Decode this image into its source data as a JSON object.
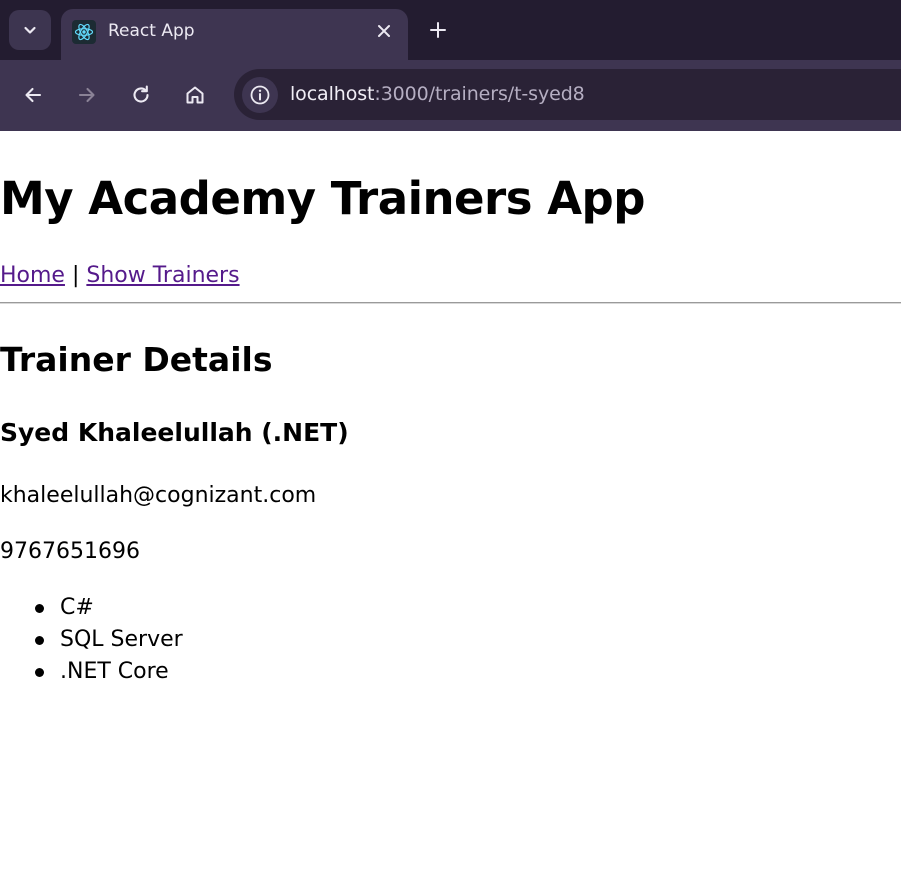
{
  "browser": {
    "tab": {
      "title": "React App",
      "favicon": "react-logo-icon",
      "close_icon": "close-icon"
    },
    "tab_search_icon": "chevron-down-icon",
    "new_tab_icon": "plus-icon",
    "toolbar": {
      "back_icon": "arrow-left-icon",
      "forward_icon": "arrow-right-icon",
      "reload_icon": "reload-icon",
      "home_icon": "home-icon",
      "site_info_icon": "info-icon"
    },
    "url": {
      "host": "localhost",
      "rest": ":3000/trainers/t-syed8"
    }
  },
  "page": {
    "app_title": "My Academy Trainers App",
    "nav": {
      "home": "Home",
      "separator": " | ",
      "show_trainers": "Show Trainers"
    },
    "section_title": "Trainer Details",
    "trainer": {
      "name": "Syed Khaleelullah (.NET)",
      "email": "khaleelullah@cognizant.com",
      "phone": "9767651696",
      "skills": [
        "C#",
        "SQL Server",
        ".NET Core"
      ]
    }
  },
  "colors": {
    "chrome_bg": "#231c30",
    "toolbar_bg": "#3e3551",
    "visited_link": "#551a8b",
    "react_cyan": "#61dafb"
  }
}
